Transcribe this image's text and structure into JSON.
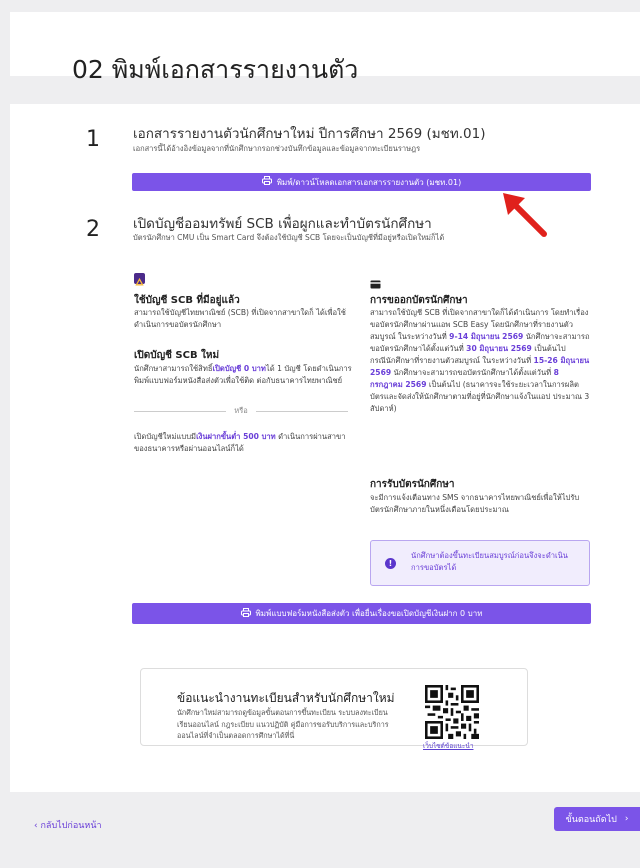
{
  "page": {
    "title": "02 พิมพ์เอกสารรายงานตัว"
  },
  "step1": {
    "number": "1",
    "title": "เอกสารรายงานตัวนักศึกษาใหม่ ปีการศึกษา 2569 (มชท.01)",
    "subtitle": "เอกสารนี้ได้อ้างอิงข้อมูลจากที่นักศึกษากรอกช่วงบันทึกข้อมูลและข้อมูลจากทะเบียนราษฎร",
    "button_label": "พิมพ์/ดาวน์โหลดเอกสารเอกสารรายงานตัว (มชท.01)",
    "button_icon": "printer-icon"
  },
  "step2": {
    "number": "2",
    "title": "เปิดบัญชีออมทรัพย์ SCB เพื่อผูกและทำบัตรนักศึกษา",
    "subtitle": "บัตรนักศึกษา CMU เป็น Smart Card จึงต้องใช้บัญชี SCB โดยจะเป็นบัญชีที่มีอยู่หรือเปิดใหม่ก็ได้",
    "left": {
      "icon": "scb-app-icon",
      "existing_heading": "ใช้บัญชี SCB ที่มีอยู่แล้ว",
      "existing_text": "สามารถใช้บัญชีไทยพาณิชย์ (SCB) ที่เปิดจากสาขาใดก็ ได้เพื่อใช้ดำเนินการขอบัตรนักศึกษา",
      "new_heading": "เปิดบัญชี SCB ใหม่",
      "new_text_1": "นักศึกษาสามารถใช้สิทธิ์",
      "new_text_hl": "เปิดบัญชี 0 บาท",
      "new_text_2": "ได้ 1 บัญชี โดยดำเนินการพิมพ์แบบฟอร์มหนังสือส่งตัวเพื่อใช้ติด ต่อกับธนาคารไทยพาณิชย์",
      "divider_text": "หรือ",
      "min_text_1": "เปิดบัญชีใหม่แบบมี",
      "min_text_hl": "เงินฝากขั้นต่ำ 500 บาท",
      "min_text_2": " ดำเนินการผ่านสาขาของธนาคารหรือผ่านออนไลน์ก็ได้"
    },
    "right": {
      "icon": "card-icon",
      "card_heading": "การขออกบัตรนักศึกษา",
      "card_text_1": "สามารถใช้บัญชี SCB ที่เปิดจากสาขาใดก็ได้ดำเนินการ โดยทำเรื่องขอบัตรนักศึกษาผ่านแอพ SCB Easy โดยนักศึกษาที่รายงานตัวสมบูรณ์ ในระหว่างวันที่ ",
      "card_hl_1": "9-14 มิถุนายน 2569",
      "card_text_2": " นักศึกษาจะสามารถขอบัตรนักศึกษาได้ตั้งแต่วันที่ ",
      "card_hl_2": "30 มิถุนายน 2569",
      "card_text_3": " เป็นต้นไป",
      "card_text_4": "กรณีนักศึกษาที่รายงานตัวสมบูรณ์ ในระหว่างวันที่ ",
      "card_hl_3": "15-26 มิถุนายน 2569",
      "card_text_5": " นักศึกษาจะสามารถขอบัตรนักศึกษาได้ตั้งแต่วันที่ ",
      "card_hl_4": "8 กรกฎาคม 2569",
      "card_text_6": " เป็นต้นไป (ธนาคารจะใช้ระยะเวลาในการผลิตบัตรและจัดส่งให้นักศึกษาตามที่อยู่ที่นักศึกษาแจ้งในแอป ประมาณ 3 สัปดาห์)",
      "receive_heading": "การรับบัตรนักศึกษา",
      "receive_text": "จะมีการแจ้งเตือนทาง SMS จากธนาคารไทยพาณิชย์เพื่อให้ไปรับบัตรนักศึกษาภายในหนึ่งเดือนโดยประมาณ",
      "notice_text": "นักศึกษาต้องขึ้นทะเบียนสมบูรณ์ก่อนจึงจะดำเนินการขอบัตรได้",
      "notice_icon": "alert-icon"
    },
    "button_label": "พิมพ์แบบฟอร์มหนังสือส่งตัว เพื่อยื่นเรื่องขอเปิดบัญชีเงินฝาก 0 บาท",
    "button_icon": "printer-icon"
  },
  "advice": {
    "title": "ข้อแนะนำงานทะเบียนสำหรับนักศึกษาใหม่",
    "text": "นักศึกษาใหม่สามารถดูข้อมูลขั้นตอนการขึ้นทะเบียน ระบบลงทะเบียนเรียนออนไลน์ กฎระเบียบ แนวปฏิบัติ คู่มือการขอรับบริการและบริการออนไลน์ที่จำเป็นตลอดการศึกษาได้ที่นี่",
    "qr_caption": "เว็บไซต์ข้อแนะนำ",
    "qr_icon": "qr-code-icon"
  },
  "footer": {
    "back_label": "กลับไปก่อนหน้า",
    "next_label": "ขั้นตอนถัดไป"
  },
  "colors": {
    "accent": "#7b54e8",
    "highlight": "#6a3fd8",
    "arrow": "#e0211c"
  }
}
